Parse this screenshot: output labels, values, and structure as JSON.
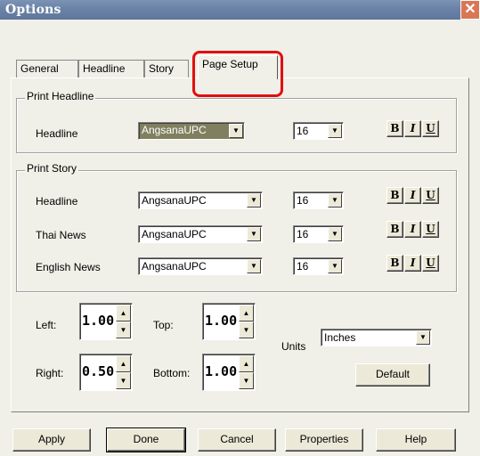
{
  "window": {
    "title": "Options",
    "close_glyph": "✕"
  },
  "tabs": [
    "General",
    "Headline",
    "Story",
    "Page Setup"
  ],
  "print_headline": {
    "legend": "Print Headline",
    "rows": [
      {
        "label": "Headline",
        "font": "AngsanaUPC",
        "size": "16"
      }
    ]
  },
  "print_story": {
    "legend": "Print Story",
    "rows": [
      {
        "label": "Headline",
        "font": "AngsanaUPC",
        "size": "16"
      },
      {
        "label": "Thai News",
        "font": "AngsanaUPC",
        "size": "16"
      },
      {
        "label": "English News",
        "font": "AngsanaUPC",
        "size": "16"
      }
    ]
  },
  "format": {
    "bold": "B",
    "italic": "I",
    "underline": "U"
  },
  "margins": {
    "left_label": "Left:",
    "left_value": "1.00",
    "top_label": "Top:",
    "top_value": "1.00",
    "right_label": "Right:",
    "right_value": "0.50",
    "bottom_label": "Bottom:",
    "bottom_value": "1.00",
    "units_label": "Units",
    "units_value": "Inches",
    "default_label": "Default"
  },
  "buttons": {
    "apply": "Apply",
    "done": "Done",
    "cancel": "Cancel",
    "properties": "Properties",
    "help": "Help"
  },
  "glyphs": {
    "arrow_down": "▼",
    "arrow_up": "▲"
  },
  "colors": {
    "highlight": "#e01010",
    "selection": "#808060"
  }
}
